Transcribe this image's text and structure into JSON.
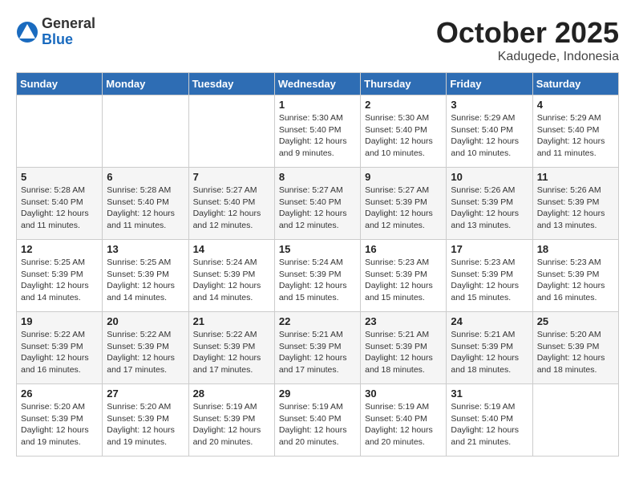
{
  "header": {
    "logo_general": "General",
    "logo_blue": "Blue",
    "month": "October 2025",
    "location": "Kadugede, Indonesia"
  },
  "weekdays": [
    "Sunday",
    "Monday",
    "Tuesday",
    "Wednesday",
    "Thursday",
    "Friday",
    "Saturday"
  ],
  "weeks": [
    [
      {
        "day": "",
        "info": ""
      },
      {
        "day": "",
        "info": ""
      },
      {
        "day": "",
        "info": ""
      },
      {
        "day": "1",
        "info": "Sunrise: 5:30 AM\nSunset: 5:40 PM\nDaylight: 12 hours\nand 9 minutes."
      },
      {
        "day": "2",
        "info": "Sunrise: 5:30 AM\nSunset: 5:40 PM\nDaylight: 12 hours\nand 10 minutes."
      },
      {
        "day": "3",
        "info": "Sunrise: 5:29 AM\nSunset: 5:40 PM\nDaylight: 12 hours\nand 10 minutes."
      },
      {
        "day": "4",
        "info": "Sunrise: 5:29 AM\nSunset: 5:40 PM\nDaylight: 12 hours\nand 11 minutes."
      }
    ],
    [
      {
        "day": "5",
        "info": "Sunrise: 5:28 AM\nSunset: 5:40 PM\nDaylight: 12 hours\nand 11 minutes."
      },
      {
        "day": "6",
        "info": "Sunrise: 5:28 AM\nSunset: 5:40 PM\nDaylight: 12 hours\nand 11 minutes."
      },
      {
        "day": "7",
        "info": "Sunrise: 5:27 AM\nSunset: 5:40 PM\nDaylight: 12 hours\nand 12 minutes."
      },
      {
        "day": "8",
        "info": "Sunrise: 5:27 AM\nSunset: 5:40 PM\nDaylight: 12 hours\nand 12 minutes."
      },
      {
        "day": "9",
        "info": "Sunrise: 5:27 AM\nSunset: 5:39 PM\nDaylight: 12 hours\nand 12 minutes."
      },
      {
        "day": "10",
        "info": "Sunrise: 5:26 AM\nSunset: 5:39 PM\nDaylight: 12 hours\nand 13 minutes."
      },
      {
        "day": "11",
        "info": "Sunrise: 5:26 AM\nSunset: 5:39 PM\nDaylight: 12 hours\nand 13 minutes."
      }
    ],
    [
      {
        "day": "12",
        "info": "Sunrise: 5:25 AM\nSunset: 5:39 PM\nDaylight: 12 hours\nand 14 minutes."
      },
      {
        "day": "13",
        "info": "Sunrise: 5:25 AM\nSunset: 5:39 PM\nDaylight: 12 hours\nand 14 minutes."
      },
      {
        "day": "14",
        "info": "Sunrise: 5:24 AM\nSunset: 5:39 PM\nDaylight: 12 hours\nand 14 minutes."
      },
      {
        "day": "15",
        "info": "Sunrise: 5:24 AM\nSunset: 5:39 PM\nDaylight: 12 hours\nand 15 minutes."
      },
      {
        "day": "16",
        "info": "Sunrise: 5:23 AM\nSunset: 5:39 PM\nDaylight: 12 hours\nand 15 minutes."
      },
      {
        "day": "17",
        "info": "Sunrise: 5:23 AM\nSunset: 5:39 PM\nDaylight: 12 hours\nand 15 minutes."
      },
      {
        "day": "18",
        "info": "Sunrise: 5:23 AM\nSunset: 5:39 PM\nDaylight: 12 hours\nand 16 minutes."
      }
    ],
    [
      {
        "day": "19",
        "info": "Sunrise: 5:22 AM\nSunset: 5:39 PM\nDaylight: 12 hours\nand 16 minutes."
      },
      {
        "day": "20",
        "info": "Sunrise: 5:22 AM\nSunset: 5:39 PM\nDaylight: 12 hours\nand 17 minutes."
      },
      {
        "day": "21",
        "info": "Sunrise: 5:22 AM\nSunset: 5:39 PM\nDaylight: 12 hours\nand 17 minutes."
      },
      {
        "day": "22",
        "info": "Sunrise: 5:21 AM\nSunset: 5:39 PM\nDaylight: 12 hours\nand 17 minutes."
      },
      {
        "day": "23",
        "info": "Sunrise: 5:21 AM\nSunset: 5:39 PM\nDaylight: 12 hours\nand 18 minutes."
      },
      {
        "day": "24",
        "info": "Sunrise: 5:21 AM\nSunset: 5:39 PM\nDaylight: 12 hours\nand 18 minutes."
      },
      {
        "day": "25",
        "info": "Sunrise: 5:20 AM\nSunset: 5:39 PM\nDaylight: 12 hours\nand 18 minutes."
      }
    ],
    [
      {
        "day": "26",
        "info": "Sunrise: 5:20 AM\nSunset: 5:39 PM\nDaylight: 12 hours\nand 19 minutes."
      },
      {
        "day": "27",
        "info": "Sunrise: 5:20 AM\nSunset: 5:39 PM\nDaylight: 12 hours\nand 19 minutes."
      },
      {
        "day": "28",
        "info": "Sunrise: 5:19 AM\nSunset: 5:39 PM\nDaylight: 12 hours\nand 20 minutes."
      },
      {
        "day": "29",
        "info": "Sunrise: 5:19 AM\nSunset: 5:40 PM\nDaylight: 12 hours\nand 20 minutes."
      },
      {
        "day": "30",
        "info": "Sunrise: 5:19 AM\nSunset: 5:40 PM\nDaylight: 12 hours\nand 20 minutes."
      },
      {
        "day": "31",
        "info": "Sunrise: 5:19 AM\nSunset: 5:40 PM\nDaylight: 12 hours\nand 21 minutes."
      },
      {
        "day": "",
        "info": ""
      }
    ]
  ]
}
